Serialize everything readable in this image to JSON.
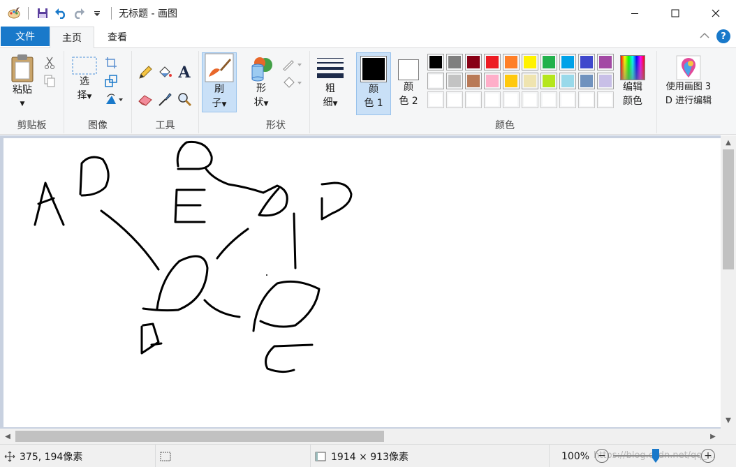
{
  "window": {
    "title": "无标题 - 画图",
    "icons": [
      "paint-app-icon",
      "save-icon",
      "undo-icon",
      "redo-icon",
      "customize-dropdown-icon",
      "minimize-icon",
      "maximize-icon",
      "close-icon"
    ]
  },
  "tabs": {
    "file": "文件",
    "home": "主页",
    "view": "查看",
    "help": "?"
  },
  "ribbon": {
    "clipboard": {
      "paste": "粘贴",
      "group_label": "剪贴板"
    },
    "image": {
      "select_line1": "选",
      "select_line2": "择",
      "group_label": "图像"
    },
    "tools": {
      "group_label": "工具"
    },
    "brush": {
      "line1": "刷",
      "line2": "子"
    },
    "shapes": {
      "line1": "形",
      "line2": "状",
      "group_label": "形状"
    },
    "size": {
      "line1": "粗",
      "line2": "细"
    },
    "colors": {
      "color1_line1": "颜",
      "color1_line2": "色 1",
      "color2_line1": "颜",
      "color2_line2": "色 2",
      "edit_line1": "编辑",
      "edit_line2": "颜色",
      "group_label": "颜色",
      "color1": "#000000",
      "color2": "#ffffff",
      "palette_row1": [
        "#000000",
        "#7f7f7f",
        "#880015",
        "#ed1c24",
        "#ff7f27",
        "#fff200",
        "#22b14c",
        "#00a2e8",
        "#3f48cc",
        "#a349a4"
      ],
      "palette_row2": [
        "#ffffff",
        "#c3c3c3",
        "#b97a57",
        "#ffaec9",
        "#ffc90e",
        "#efe4b0",
        "#b5e61d",
        "#99d9ea",
        "#7092be",
        "#c8bfe7"
      ],
      "palette_row3": [
        "#ffffff",
        "#ffffff",
        "#ffffff",
        "#ffffff",
        "#ffffff",
        "#ffffff",
        "#ffffff",
        "#ffffff",
        "#ffffff",
        "#ffffff"
      ]
    },
    "paint3d": {
      "line1": "使用画图 3",
      "line2": "D 进行编辑"
    }
  },
  "status": {
    "cursor_pos": "375, 194像素",
    "canvas_size": "1914 × 913像素",
    "zoom": "100%",
    "watermark": "https://blog.csdn.net/qq_..."
  }
}
